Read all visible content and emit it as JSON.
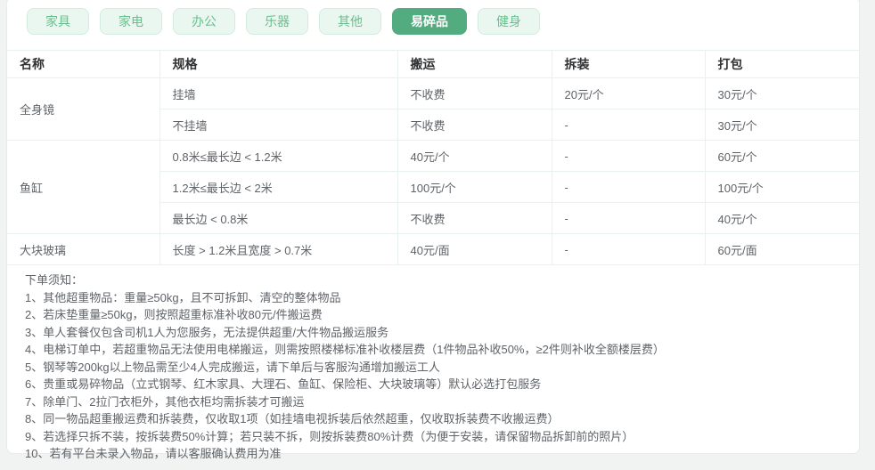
{
  "tabs": [
    {
      "label": "家具",
      "active": false
    },
    {
      "label": "家电",
      "active": false
    },
    {
      "label": "办公",
      "active": false
    },
    {
      "label": "乐器",
      "active": false
    },
    {
      "label": "其他",
      "active": false
    },
    {
      "label": "易碎品",
      "active": true
    },
    {
      "label": "健身",
      "active": false
    }
  ],
  "table": {
    "headers": [
      "名称",
      "规格",
      "搬运",
      "拆装",
      "打包"
    ],
    "groups": [
      {
        "name": "全身镜",
        "rows": [
          {
            "spec": "挂墙",
            "move": "不收费",
            "disassemble": "20元/个",
            "pack": "30元/个"
          },
          {
            "spec": "不挂墙",
            "move": "不收费",
            "disassemble": "-",
            "pack": "30元/个"
          }
        ]
      },
      {
        "name": "鱼缸",
        "rows": [
          {
            "spec": "0.8米≤最长边 < 1.2米",
            "move": "40元/个",
            "disassemble": "-",
            "pack": "60元/个"
          },
          {
            "spec": "1.2米≤最长边 < 2米",
            "move": "100元/个",
            "disassemble": "-",
            "pack": "100元/个"
          },
          {
            "spec": "最长边 < 0.8米",
            "move": "不收费",
            "disassemble": "-",
            "pack": "40元/个"
          }
        ]
      },
      {
        "name": "大块玻璃",
        "rows": [
          {
            "spec": "长度 > 1.2米且宽度 > 0.7米",
            "move": "40元/面",
            "disassemble": "-",
            "pack": "60元/面"
          }
        ]
      }
    ]
  },
  "notes": {
    "title": "下单须知：",
    "items": [
      "1、其他超重物品：重量≥50kg，且不可拆卸、清空的整体物品",
      "2、若床垫重量≥50kg，则按照超重标准补收80元/件搬运费",
      "3、单人套餐仅包含司机1人为您服务，无法提供超重/大件物品搬运服务",
      "4、电梯订单中，若超重物品无法使用电梯搬运，则需按照楼梯标准补收楼层费（1件物品补收50%，≥2件则补收全额楼层费）",
      "5、钢琴等200kg以上物品需至少4人完成搬运，请下单后与客服沟通增加搬运工人",
      "6、贵重或易碎物品（立式钢琴、红木家具、大理石、鱼缸、保险柜、大块玻璃等）默认必选打包服务",
      "7、除单门、2拉门衣柜外，其他衣柜均需拆装才可搬运",
      "8、同一物品超重搬运费和拆装费，仅收取1项（如挂墙电视拆装后依然超重，仅收取拆装费不收搬运费）",
      "9、若选择只拆不装，按拆装费50%计算；若只装不拆，则按拆装费80%计费（为便于安装，请保留物品拆卸前的照片）",
      "10、若有平台未录入物品，请以客服确认费用为准"
    ]
  },
  "colors": {
    "accent": "#53ab80",
    "tab-bg": "#eaf7f0",
    "tab-border": "#d2ecdd",
    "tab-text": "#6abf8e",
    "table-border": "#e9f1ec",
    "card-border": "#e4ede7",
    "header-text": "#303133",
    "cell-text": "#5f6368",
    "page-bg": "#f1f3f2"
  }
}
